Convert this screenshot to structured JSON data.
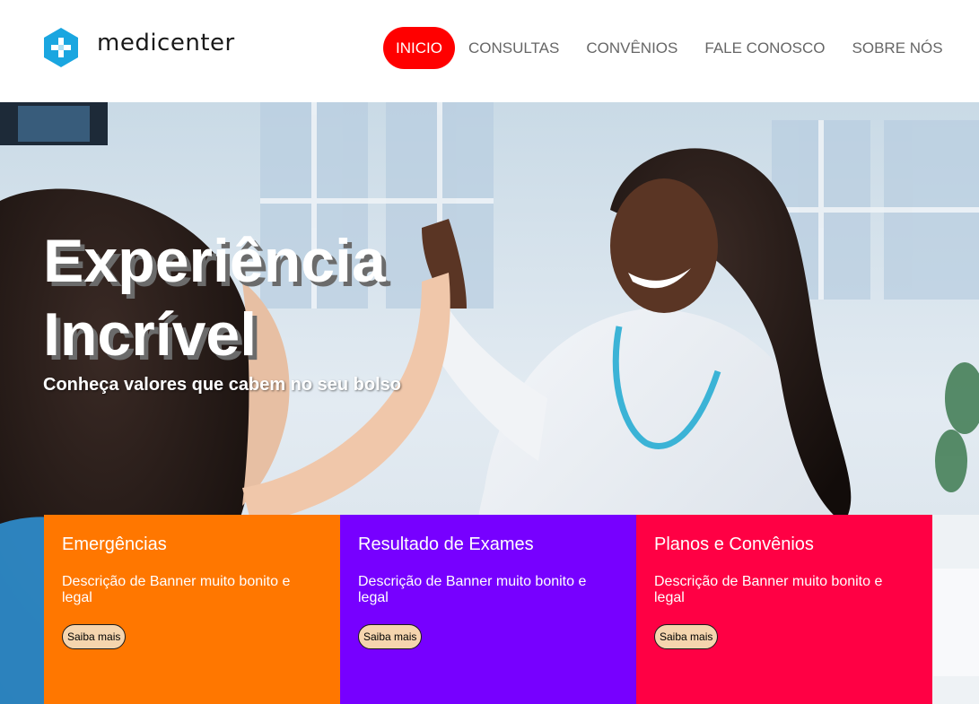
{
  "brand": {
    "name": "medicenter",
    "icon": "plus-hexagon-icon",
    "color": "#1aa6e0"
  },
  "nav": {
    "items": [
      {
        "label": "INICIO",
        "active": true
      },
      {
        "label": "CONSULTAS",
        "active": false
      },
      {
        "label": "CONVÊNIOS",
        "active": false
      },
      {
        "label": "FALE CONOSCO",
        "active": false
      },
      {
        "label": "SOBRE NÓS",
        "active": false
      }
    ],
    "active_color": "#ff0000"
  },
  "hero": {
    "title_line1": "Experiência",
    "title_line2": "Incrível",
    "subtitle": "Conheça valores que cabem no seu bolso",
    "image": "doctor-high-five-child-photo"
  },
  "cards": [
    {
      "title": "Emergências",
      "description": "Descrição de Banner muito bonito e legal",
      "button": "Saiba mais",
      "color": "#ff7700"
    },
    {
      "title": "Resultado de Exames",
      "description": "Descrição de Banner muito bonito e legal",
      "button": "Saiba mais",
      "color": "#7700ff"
    },
    {
      "title": "Planos e Convênios",
      "description": "Descrição de Banner muito bonito e legal",
      "button": "Saiba mais",
      "color": "#ff0044"
    }
  ]
}
